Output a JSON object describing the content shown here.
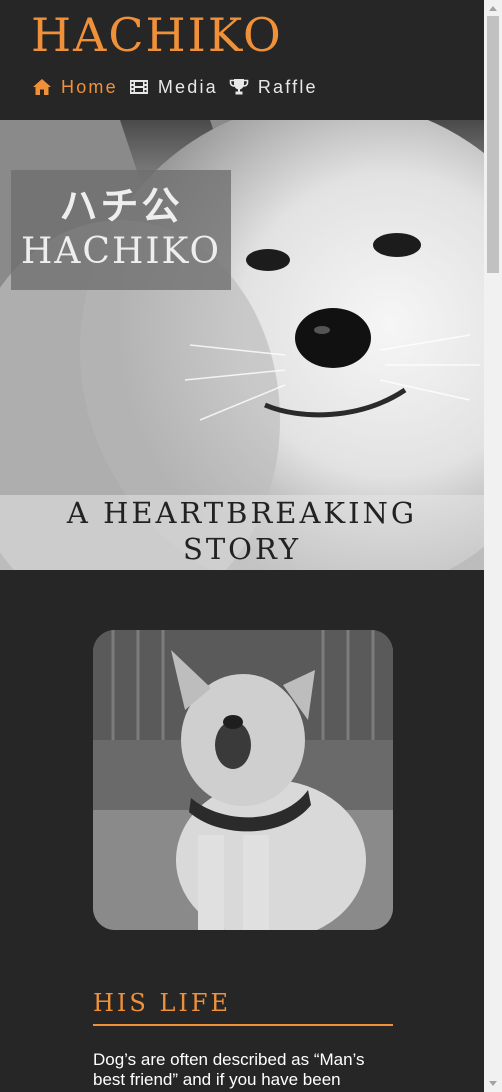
{
  "header": {
    "site_title": "HACHIKO",
    "nav": [
      {
        "label": "Home",
        "icon": "home-icon",
        "active": true
      },
      {
        "label": "Media",
        "icon": "film-icon",
        "active": false
      },
      {
        "label": "Raffle",
        "icon": "trophy-icon",
        "active": false
      }
    ]
  },
  "hero": {
    "kanji": "ハチ公",
    "name": "HACHIKO",
    "caption": "A HEARTBREAKING STORY",
    "image": "akita-dog-closeup-photo"
  },
  "portrait": {
    "image": "hachiko-historical-photo"
  },
  "section": {
    "heading": "HIS LIFE",
    "body": "Dog’s are often described as “Man’s best friend” and if you have been"
  },
  "colors": {
    "accent": "#f0913a",
    "background": "#262626",
    "text": "#ffffff"
  }
}
